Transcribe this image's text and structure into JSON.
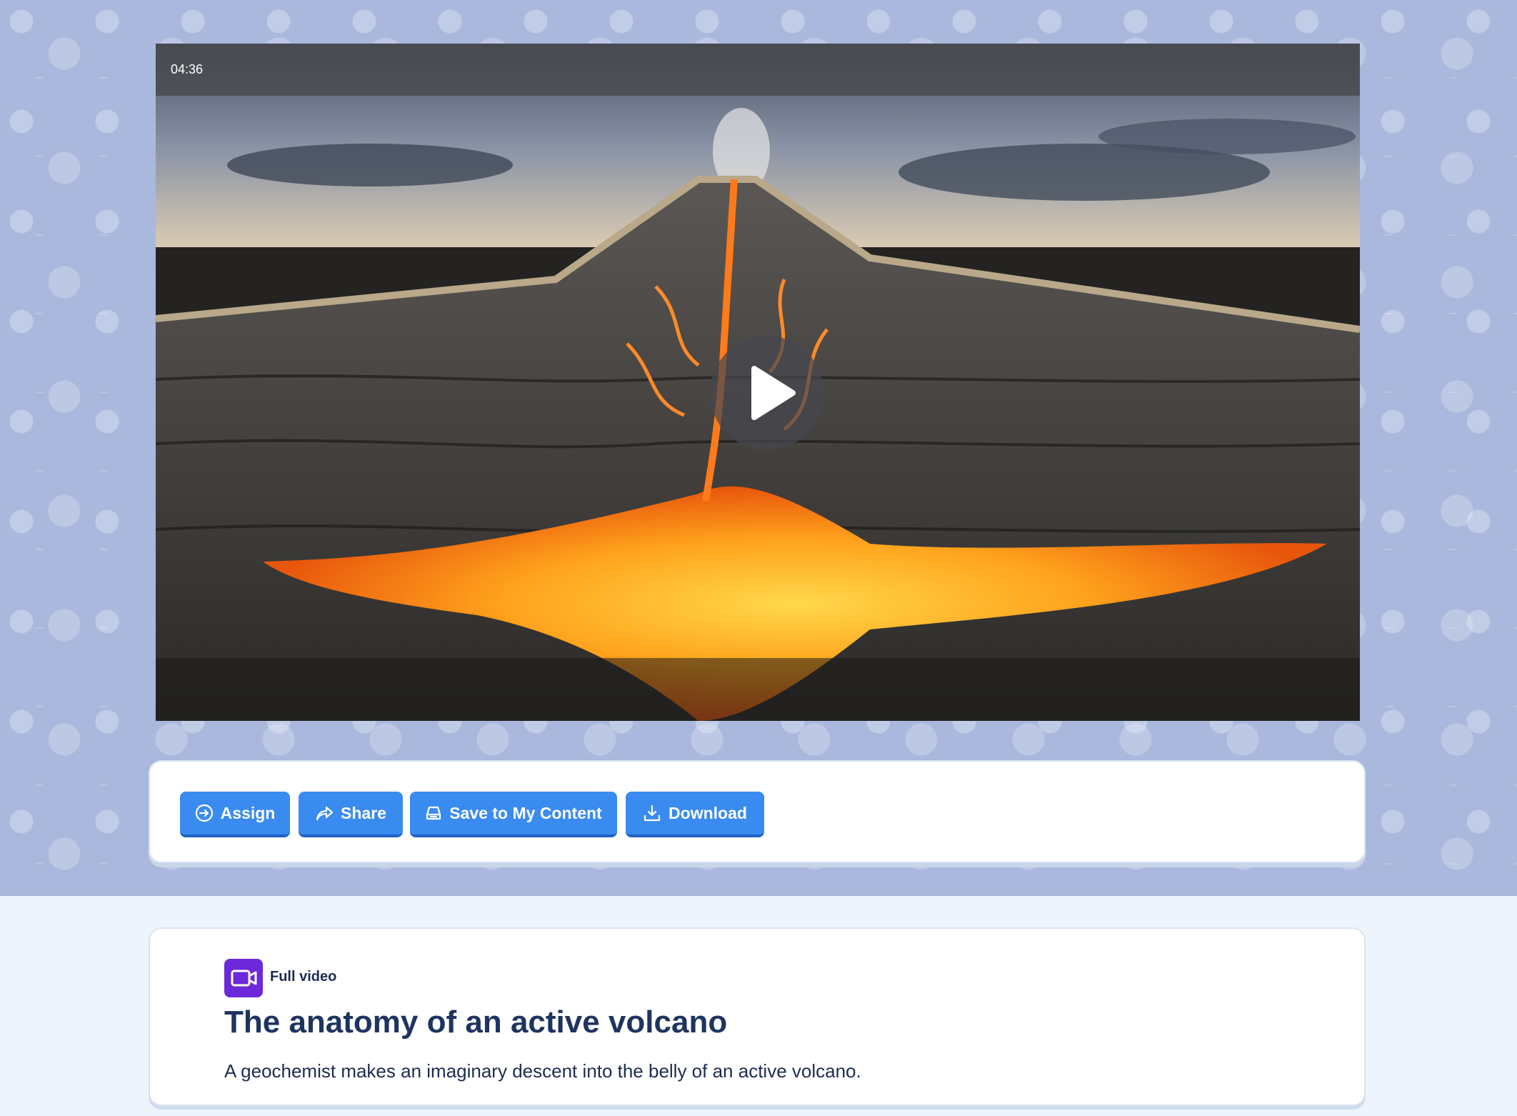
{
  "video": {
    "duration": "04:36"
  },
  "actions": {
    "assign_label": "Assign",
    "share_label": "Share",
    "save_label": "Save to My Content",
    "download_label": "Download"
  },
  "info": {
    "type_label": "Full video",
    "title": "The anatomy of an active volcano",
    "description": "A geochemist makes an imaginary descent into the belly of an active volcano."
  },
  "colors": {
    "hero_background": "#a9b8dc",
    "page_background": "#eef4fc",
    "button_primary": "#3a8bf0",
    "title_navy": "#1e3460",
    "video_badge_purple": "#6d28d9"
  },
  "icons": {
    "play": "play-icon",
    "assign": "assign-arrow-circle-icon",
    "share": "share-arrow-icon",
    "save": "save-tray-icon",
    "download": "download-icon",
    "video_type": "video-camera-icon"
  }
}
